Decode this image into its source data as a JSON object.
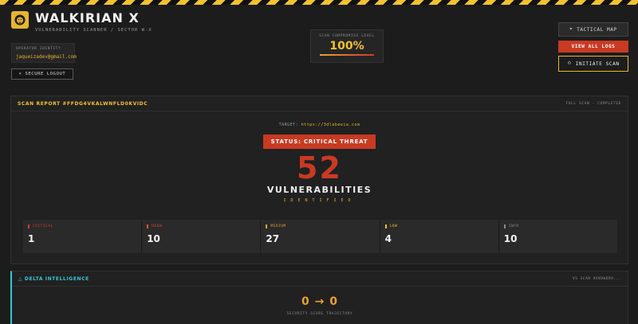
{
  "header": {
    "title": "WALKIRIAN X",
    "subtitle": "VULNERABILITY SCANNER / SECTOR W-X",
    "operator_label": "OPERATOR IDENTITY",
    "operator_value": "jaqueizadev@gmail.com",
    "logout_label": "× SECURE LOGOUT",
    "compromise_label": "SCAN COMPROMISE LEVEL",
    "compromise_value": "100%",
    "compromise_fraction": 1.0,
    "buttons": {
      "tactical_map": "TACTICAL MAP",
      "view_logs": "VIEW ALL LOGS",
      "initiate_scan": "INITIATE SCAN"
    }
  },
  "report": {
    "title": "SCAN REPORT #FFDG4VKALWNFLD0KVIDC",
    "mode": "FULL SCAN - COMPLETED",
    "target_label": "TARGET:",
    "target_url": "https://3dlabeeia.com",
    "status": "STATUS: CRITICAL THREAT",
    "count": "52",
    "count_label": "VULNERABILITIES",
    "count_sub": "IDENTIFIED",
    "severities": [
      {
        "name": "CRITICAL",
        "count": "1",
        "color": "#d6372a"
      },
      {
        "name": "HIGH",
        "count": "10",
        "color": "#e0542f"
      },
      {
        "name": "MEDIUM",
        "count": "27",
        "color": "#e7a32f"
      },
      {
        "name": "LOW",
        "count": "4",
        "color": "#f2c230"
      },
      {
        "name": "INFO",
        "count": "10",
        "color": "#8a8a8a"
      }
    ]
  },
  "delta": {
    "title": "△ DELTA INTELLIGENCE",
    "meta": "VS SCAN #XNVW8R9...",
    "score": "0 → 0",
    "caption": "SECURITY SCORE TRAJECTORY"
  },
  "colors": {
    "accent": "#f2c230",
    "danger": "#c93a23",
    "cyan": "#37c7d6",
    "background": "#1c1c1c"
  }
}
